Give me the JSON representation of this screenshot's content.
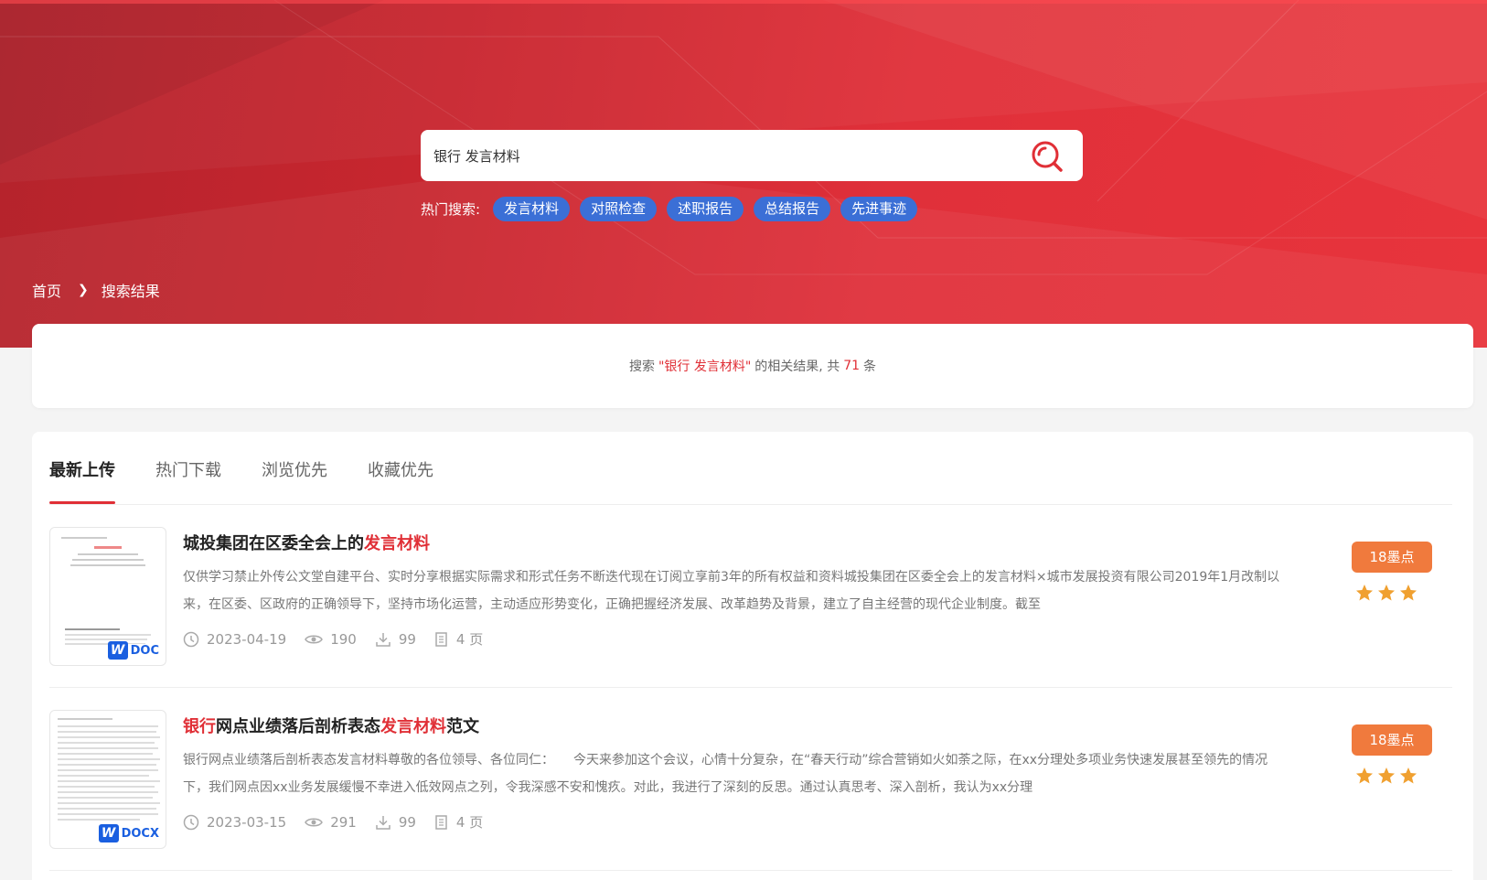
{
  "search": {
    "value": "银行 发言材料",
    "hot_label": "热门搜索:",
    "hot_tags": [
      "发言材料",
      "对照检查",
      "述职报告",
      "总结报告",
      "先进事迹"
    ]
  },
  "breadcrumb": {
    "home": "首页",
    "current": "搜索结果"
  },
  "summary": {
    "prefix": "搜索",
    "query": "\"银行 发言材料\"",
    "middle": "的相关结果, 共",
    "count": "71",
    "suffix": "条"
  },
  "tabs": [
    "最新上传",
    "热门下载",
    "浏览优先",
    "收藏优先"
  ],
  "results": [
    {
      "title_parts": [
        {
          "text": "城投集团在区委全会上的",
          "hl": false
        },
        {
          "text": "发言材料",
          "hl": true
        }
      ],
      "desc": "仅供学习禁止外传公文堂自建平台、实时分享根据实际需求和形式任务不断迭代现在订阅立享前3年的所有权益和资料城投集团在区委全会上的发言材料×城市发展投资有限公司2019年1月改制以来，在区委、区政府的正确领导下，坚持市场化运营，主动适应形势变化，正确把握经济发展、改革趋势及背景，建立了自主经营的现代企业制度。截至",
      "date": "2023-04-19",
      "views": "190",
      "downloads": "99",
      "pages": "4 页",
      "price": "18墨点",
      "stars": 3,
      "file_type": "DOC",
      "thumb_title": "公文堂"
    },
    {
      "title_parts": [
        {
          "text": "银行",
          "hl": true
        },
        {
          "text": "网点业绩落后剖析表态",
          "hl": false
        },
        {
          "text": "发言材料",
          "hl": true
        },
        {
          "text": "范文",
          "hl": false
        }
      ],
      "desc": "银行网点业绩落后剖析表态发言材料尊敬的各位领导、各位同仁：　　今天来参加这个会议，心情十分复杂，在“春天行动”综合营销如火如荼之际，在xx分理处多项业务快速发展甚至领先的情况下，我们网点因xx业务发展缓慢不幸进入低效网点之列，令我深感不安和愧疚。对此，我进行了深刻的反思。通过认真思考、深入剖析，我认为xx分理",
      "date": "2023-03-15",
      "views": "291",
      "downloads": "99",
      "pages": "4 页",
      "price": "18墨点",
      "stars": 3,
      "file_type": "DOCX",
      "thumb_title": ""
    }
  ],
  "colors": {
    "brand_red": "#e02f36",
    "tag_blue": "#3b6fd6",
    "price_orange": "#f07a3d",
    "star": "#f0a030"
  }
}
